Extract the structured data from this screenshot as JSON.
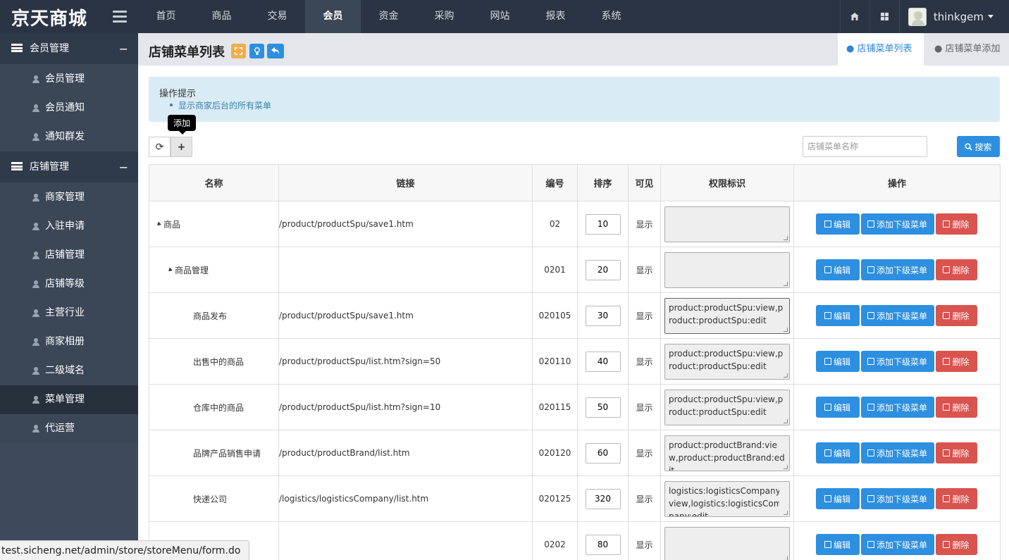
{
  "brand": {
    "title": "京天商城"
  },
  "nav": {
    "items": [
      "首页",
      "商品",
      "交易",
      "会员",
      "资金",
      "采购",
      "网站",
      "报表",
      "系统"
    ],
    "active_index": 3
  },
  "user": {
    "name": "thinkgem"
  },
  "sidebar": {
    "groups": [
      {
        "label": "会员管理",
        "toggle": "−",
        "items": [
          "会员管理",
          "会员通知",
          "通知群发"
        ]
      },
      {
        "label": "店铺管理",
        "toggle": "−",
        "items": [
          "商家管理",
          "入驻申请",
          "店铺管理",
          "店铺等级",
          "主营行业",
          "商家相册",
          "二级域名",
          "菜单管理",
          "代运营"
        ]
      }
    ],
    "active_item": "菜单管理"
  },
  "header": {
    "title": "店铺菜单列表",
    "tabs": [
      "店铺菜单列表",
      "店铺菜单添加"
    ],
    "active_tab": 0
  },
  "alert": {
    "title": "操作提示",
    "lines": [
      "显示商家后台的所有菜单"
    ]
  },
  "toolbar": {
    "tooltip": "添加",
    "refresh_icon": "⟳",
    "add_icon": "+",
    "search_placeholder": "店铺菜单名称",
    "search_label": "搜索"
  },
  "table": {
    "headers": [
      "名称",
      "链接",
      "编号",
      "排序",
      "可见",
      "权限标识",
      "操作"
    ],
    "actions": {
      "edit": "编辑",
      "add_child": "添加下级菜单",
      "delete": "删除"
    },
    "rows": [
      {
        "name": "商品",
        "level": 0,
        "expand": true,
        "link": "/product/productSpu/save1.htm",
        "code": "02",
        "sort": "10",
        "visible": "显示",
        "perm": ""
      },
      {
        "name": "商品管理",
        "level": 1,
        "expand": true,
        "link": "",
        "code": "0201",
        "sort": "20",
        "visible": "显示",
        "perm": ""
      },
      {
        "name": "商品发布",
        "level": 2,
        "expand": false,
        "link": "/product/productSpu/save1.htm",
        "code": "020105",
        "sort": "30",
        "visible": "显示",
        "perm": "product:productSpu:view,product:productSpu:edit"
      },
      {
        "name": "出售中的商品",
        "level": 2,
        "expand": false,
        "link": "/product/productSpu/list.htm?sign=50",
        "code": "020110",
        "sort": "40",
        "visible": "显示",
        "perm": "product:productSpu:view,product:productSpu:edit"
      },
      {
        "name": "仓库中的商品",
        "level": 2,
        "expand": false,
        "link": "/product/productSpu/list.htm?sign=10",
        "code": "020115",
        "sort": "50",
        "visible": "显示",
        "perm": "product:productSpu:view,product:productSpu:edit"
      },
      {
        "name": "品牌产品销售申请",
        "level": 2,
        "expand": false,
        "link": "/product/productBrand/list.htm",
        "code": "020120",
        "sort": "60",
        "visible": "显示",
        "perm": "product:productBrand:view,product:productBrand:edit"
      },
      {
        "name": "快递公司",
        "level": 2,
        "expand": false,
        "link": "/logistics/logisticsCompany/list.htm",
        "code": "020125",
        "sort": "320",
        "visible": "显示",
        "perm": "logistics:logisticsCompany:view,logistics:logisticsCompany:edit"
      },
      {
        "name": "",
        "level": 1,
        "expand": false,
        "link": "",
        "code": "0202",
        "sort": "80",
        "visible": "显示",
        "perm": ""
      }
    ]
  },
  "status_url": "test.sicheng.net/admin/store/storeMenu/form.do"
}
